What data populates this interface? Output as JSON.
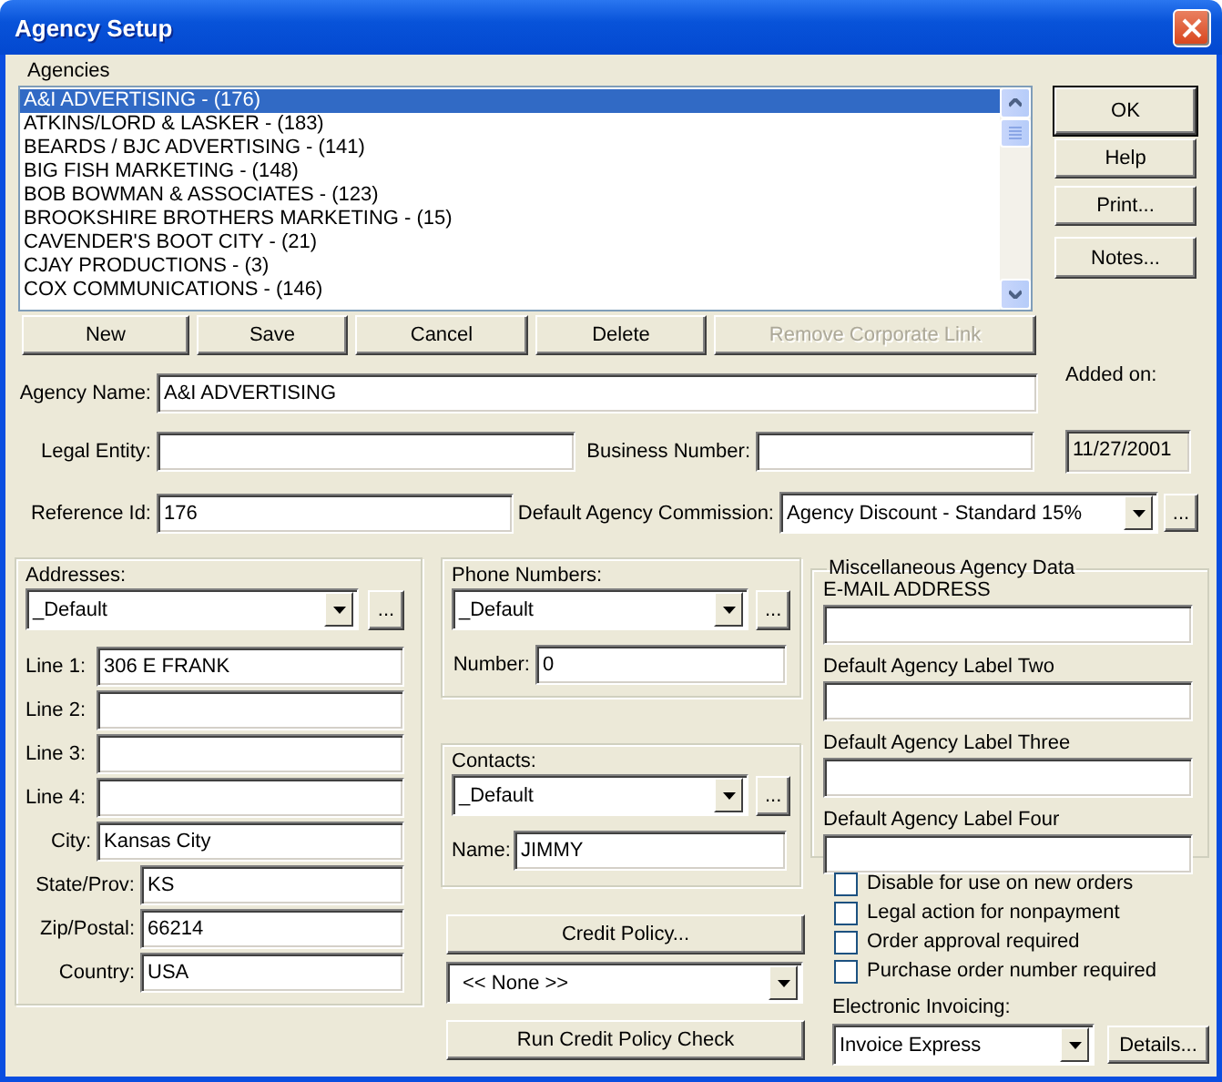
{
  "window": {
    "title": "Agency Setup"
  },
  "agencies": {
    "label": "Agencies",
    "items": [
      {
        "text": "A&I ADVERTISING - (176)",
        "selected": true
      },
      {
        "text": "ATKINS/LORD & LASKER - (183)",
        "selected": false
      },
      {
        "text": "BEARDS / BJC ADVERTISING - (141)",
        "selected": false
      },
      {
        "text": "BIG FISH MARKETING - (148)",
        "selected": false
      },
      {
        "text": "BOB BOWMAN & ASSOCIATES - (123)",
        "selected": false
      },
      {
        "text": "BROOKSHIRE BROTHERS MARKETING - (15)",
        "selected": false
      },
      {
        "text": "CAVENDER'S BOOT CITY - (21)",
        "selected": false
      },
      {
        "text": "CJAY PRODUCTIONS - (3)",
        "selected": false
      },
      {
        "text": "COX COMMUNICATIONS - (146)",
        "selected": false
      }
    ]
  },
  "list_buttons": [
    {
      "label": "New",
      "disabled": false
    },
    {
      "label": "Save",
      "disabled": false
    },
    {
      "label": "Cancel",
      "disabled": false
    },
    {
      "label": "Delete",
      "disabled": false
    },
    {
      "label": "Remove Corporate Link",
      "disabled": true
    }
  ],
  "side_buttons": [
    {
      "label": "OK",
      "default": true
    },
    {
      "label": "Help",
      "default": false
    },
    {
      "label": "Print...",
      "default": false
    },
    {
      "label": "Notes...",
      "default": false
    }
  ],
  "agency_name": {
    "label": "Agency Name:",
    "value": "A&I ADVERTISING"
  },
  "legal_entity": {
    "label": "Legal Entity:"
  },
  "business_number": {
    "label": "Business Number:"
  },
  "added_on": {
    "label": "Added on:",
    "value": "11/27/2001"
  },
  "reference_id": {
    "label": "Reference Id:",
    "value": "176"
  },
  "default_commission": {
    "label": "Default Agency Commission:",
    "selection": "Agency Discount - Standard 15%",
    "more": "..."
  },
  "addresses": {
    "label": "Addresses:",
    "selection": "_Default",
    "more": "...",
    "fields": [
      {
        "label": "Line 1:",
        "value": "306 E FRANK"
      },
      {
        "label": "Line 2:"
      },
      {
        "label": "Line 3:"
      },
      {
        "label": "Line 4:"
      },
      {
        "label": "City:",
        "value": "Kansas City"
      },
      {
        "label": "State/Prov:",
        "value": "KS"
      },
      {
        "label": "Zip/Postal:",
        "value": "66214"
      },
      {
        "label": "Country:",
        "value": "USA"
      }
    ]
  },
  "phone_numbers": {
    "label": "Phone Numbers:",
    "selection": "_Default",
    "more": "...",
    "field_label": "Number:",
    "field_value": "0"
  },
  "contacts": {
    "label": "Contacts:",
    "selection": "_Default",
    "more": "...",
    "field_label": "Name:",
    "field_value": "JIMMY"
  },
  "credit_policy": {
    "button": "Credit Policy...",
    "selection": "<< None >>",
    "check_button": "Run Credit Policy Check"
  },
  "misc": {
    "title": "Miscellaneous Agency Data",
    "fields": [
      {
        "label": "E-MAIL ADDRESS"
      },
      {
        "label": "Default Agency Label Two"
      },
      {
        "label": "Default Agency Label Three"
      },
      {
        "label": "Default Agency Label Four"
      }
    ]
  },
  "options": [
    {
      "label": "Disable for use on new orders",
      "checked": false
    },
    {
      "label": "Legal action for nonpayment",
      "checked": false
    },
    {
      "label": "Order approval required",
      "checked": false
    },
    {
      "label": "Purchase order number required",
      "checked": false
    }
  ],
  "electronic_invoicing": {
    "label": "Electronic Invoicing:",
    "selection": "Invoice Express",
    "details": "Details..."
  }
}
